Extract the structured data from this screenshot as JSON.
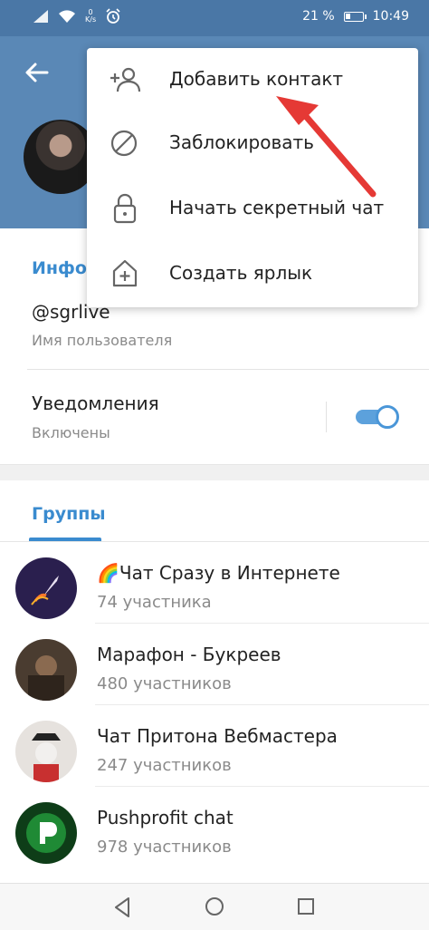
{
  "status_bar": {
    "speed_value": "0",
    "speed_unit": "K/s",
    "battery_percent": "21 %",
    "time": "10:49"
  },
  "profile": {
    "info_title": "Инфор",
    "username": "@sgrlive",
    "username_label": "Имя пользователя",
    "notifications_title": "Уведомления",
    "notifications_status": "Включены",
    "notifications_enabled": true
  },
  "groups_tab": "Группы",
  "groups": [
    {
      "name": "🌈Чат Сразу в Интернете",
      "members": "74 участника",
      "avatar_color": "#2a1f4e"
    },
    {
      "name": "Марафон - Букреев",
      "members": "480 участников",
      "avatar_color": "#5a4a3a"
    },
    {
      "name": "Чат Притона Вебмастера",
      "members": "247 участников",
      "avatar_color": "#d8d4d0"
    },
    {
      "name": "Pushprofit chat",
      "members": "978 участников",
      "avatar_color": "#1a6b2a"
    }
  ],
  "menu": [
    {
      "label": "Добавить контакт",
      "icon": "add-contact-icon"
    },
    {
      "label": "Заблокировать",
      "icon": "block-icon"
    },
    {
      "label": "Начать секретный чат",
      "icon": "lock-icon"
    },
    {
      "label": "Создать ярлык",
      "icon": "add-shortcut-icon"
    }
  ],
  "colors": {
    "header": "#5a88b6",
    "status_bar": "#4a77a6",
    "accent": "#3a8bcf",
    "annotation_arrow": "#e53935"
  }
}
